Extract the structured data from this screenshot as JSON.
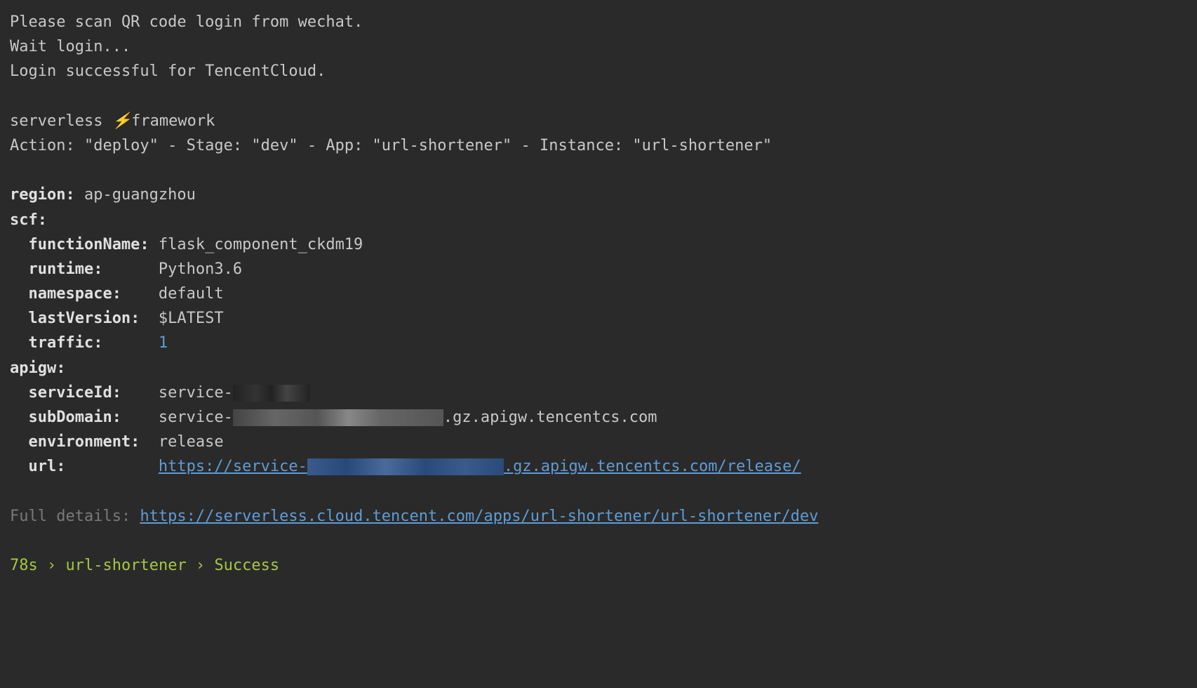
{
  "login": {
    "line1": "Please scan QR code login from wechat.",
    "line2": "Wait login...",
    "line3": "Login successful for TencentCloud."
  },
  "framework": {
    "prefix": "serverless ",
    "lightning": "⚡",
    "suffix": "framework"
  },
  "action_line": "Action: \"deploy\" - Stage: \"dev\" - App: \"url-shortener\" - Instance: \"url-shortener\"",
  "output": {
    "region_key": "region:",
    "region_val": " ap-guangzhou",
    "scf_key": "scf:",
    "scf": {
      "functionName_key": "functionName:",
      "functionName_val": "flask_component_ckdm19",
      "runtime_key": "runtime:",
      "runtime_val": "Python3.6",
      "namespace_key": "namespace:",
      "namespace_val": "default",
      "lastVersion_key": "lastVersion:",
      "lastVersion_val": "$LATEST",
      "traffic_key": "traffic:",
      "traffic_val": "1"
    },
    "apigw_key": "apigw:",
    "apigw": {
      "serviceId_key": "serviceId:",
      "serviceId_prefix": "service-",
      "subDomain_key": "subDomain:",
      "subDomain_prefix": "service-",
      "subDomain_suffix": ".gz.apigw.tencentcs.com",
      "environment_key": "environment:",
      "environment_val": "release",
      "url_key": "url:",
      "url_prefix": "https://service-",
      "url_suffix": ".gz.apigw.tencentcs.com/release/"
    }
  },
  "full_details": {
    "label": "Full details: ",
    "url": "https://serverless.cloud.tencent.com/apps/url-shortener/url-shortener/dev"
  },
  "status": {
    "time": "78s",
    "sep": " › ",
    "app": "url-shortener",
    "result": "Success"
  }
}
